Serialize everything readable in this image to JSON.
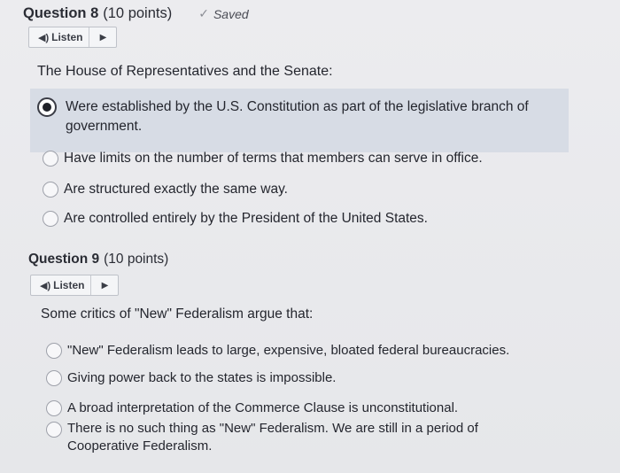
{
  "questions": [
    {
      "number": "Question 8",
      "points": "(10 points)",
      "status": "Saved",
      "listen_label": "Listen",
      "prompt": "The House of Representatives and the Senate:",
      "options": [
        {
          "text": "Were established by the U.S. Constitution as part of the legislative branch of government.",
          "selected": true
        },
        {
          "text": "Have limits on the number of terms that members can serve in office.",
          "selected": false
        },
        {
          "text": "Are structured exactly the same way.",
          "selected": false
        },
        {
          "text": "Are controlled entirely by the President of the United States.",
          "selected": false
        }
      ]
    },
    {
      "number": "Question 9",
      "points": "(10 points)",
      "listen_label": "Listen",
      "prompt": "Some critics of \"New\" Federalism argue that:",
      "options": [
        {
          "text": "\"New\" Federalism leads to large, expensive, bloated federal bureaucracies.",
          "selected": false
        },
        {
          "text": "Giving power back to the states is impossible.",
          "selected": false
        },
        {
          "text": "A broad interpretation of the Commerce Clause is unconstitutional.",
          "selected": false
        },
        {
          "text": "There is no such thing as \"New\" Federalism. We are still in a period of Cooperative Federalism.",
          "selected": false
        }
      ]
    }
  ],
  "icons": {
    "saved": "check-icon",
    "listen": "speaker-icon",
    "play": "play-icon"
  }
}
